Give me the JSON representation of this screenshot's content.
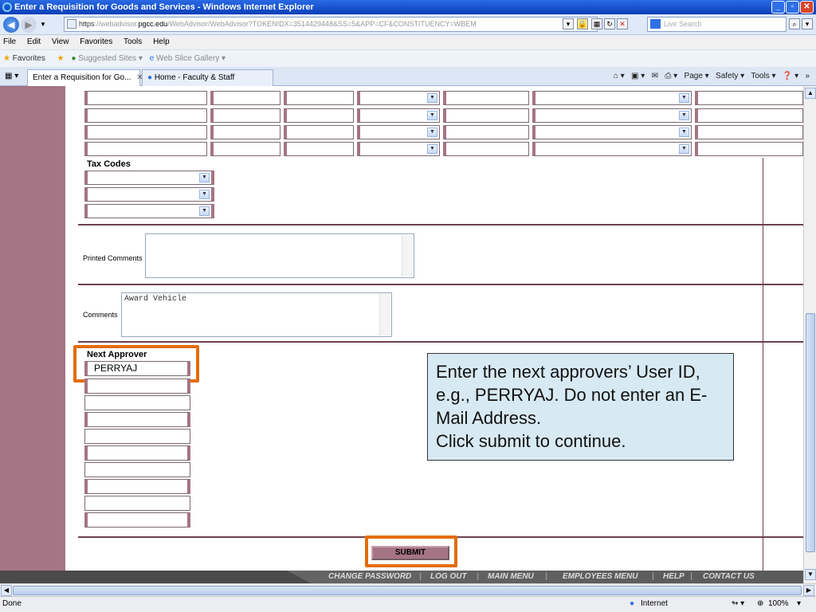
{
  "window": {
    "title": "Enter a Requisition for Goods and Services - Windows Internet Explorer"
  },
  "address": {
    "protocol": "https",
    "url_pre": "://webadvisor.",
    "domain": "pgcc.edu",
    "url_post": "/WebAdvisor/WebAdvisor?TOKENIDX=3514429448&SS=5&APP=CF&CONSTITUENCY=WBEM",
    "search_placeholder": "Live Search"
  },
  "menu": [
    "File",
    "Edit",
    "View",
    "Favorites",
    "Tools",
    "Help"
  ],
  "favorites": {
    "label": "Favorites",
    "suggested": "Suggested Sites ▾",
    "gallery": "Web Slice Gallery ▾"
  },
  "tabs": [
    {
      "label": "Enter a Requisition for Go...",
      "active": true
    },
    {
      "label": "Home - Faculty & Staff",
      "active": false
    }
  ],
  "commands": {
    "page": "Page ▾",
    "safety": "Safety ▾",
    "tools": "Tools ▾"
  },
  "form": {
    "tax_codes_label": "Tax Codes",
    "printed_comments_label": "Printed Comments",
    "printed_comments_value": "",
    "comments_label": "Comments",
    "comments_value": "Award Vehicle",
    "next_approver_label": "Next Approver",
    "next_approver_value": "PERRYAJ",
    "submit_label": "SUBMIT"
  },
  "callout": {
    "text": "Enter the next approvers’ User ID, e.g., PERRYAJ.  Do not enter an E-Mail Address.\nClick submit to continue."
  },
  "footer_links": [
    "CHANGE PASSWORD",
    "LOG OUT",
    "MAIN MENU",
    "EMPLOYEES MENU",
    "HELP",
    "CONTACT US"
  ],
  "status": {
    "left": "Done",
    "zone": "Internet",
    "zoom": "100%"
  },
  "colors": {
    "accent": "#a57485",
    "highlight": "#e36c0a",
    "callout_bg": "#d7e9f3"
  }
}
